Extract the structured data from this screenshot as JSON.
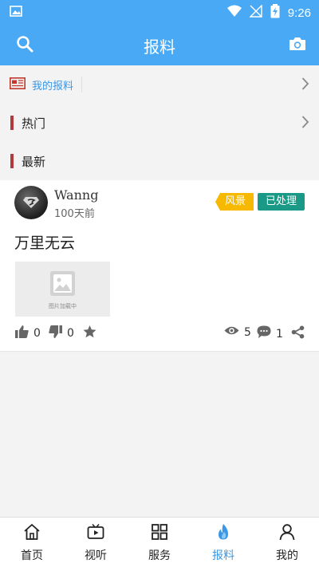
{
  "status_bar": {
    "time": "9:26"
  },
  "app_bar": {
    "title": "报料"
  },
  "sections": {
    "my_report": "我的报料",
    "hot": "热门",
    "latest": "最新"
  },
  "post": {
    "username": "Wanng",
    "time_ago": "100天前",
    "category_tag": "风景",
    "status_tag": "已处理",
    "title": "万里无云",
    "image_placeholder": "图片加载中",
    "likes": "0",
    "dislikes": "0",
    "views": "5",
    "comments": "1"
  },
  "bottom_nav": {
    "items": [
      {
        "label": "首页",
        "icon": "home-icon"
      },
      {
        "label": "视听",
        "icon": "tv-icon"
      },
      {
        "label": "服务",
        "icon": "grid-icon"
      },
      {
        "label": "报料",
        "icon": "flame-icon"
      },
      {
        "label": "我的",
        "icon": "person-icon"
      }
    ],
    "active_index": 3
  },
  "colors": {
    "primary": "#4aa9f5",
    "accent_blue": "#3a97e6",
    "section_bar": "#b33a3a",
    "tag_yellow": "#f7b900",
    "tag_teal": "#1a9a86"
  }
}
